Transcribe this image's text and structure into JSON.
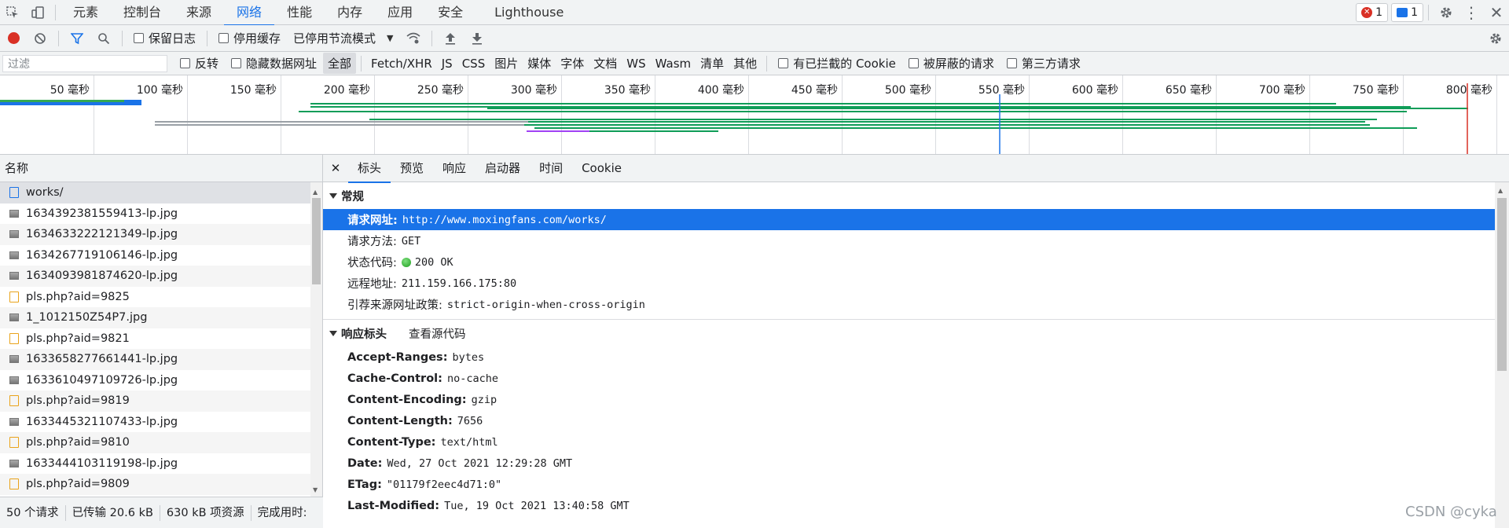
{
  "tabs": [
    {
      "label": "元素"
    },
    {
      "label": "控制台"
    },
    {
      "label": "来源"
    },
    {
      "label": "网络"
    },
    {
      "label": "性能"
    },
    {
      "label": "内存"
    },
    {
      "label": "应用"
    },
    {
      "label": "安全"
    },
    {
      "label": "Lighthouse"
    }
  ],
  "badges": {
    "errors": "1",
    "messages": "1"
  },
  "toolbar": {
    "preserve_log": "保留日志",
    "disable_cache": "停用缓存",
    "throttling": "已停用节流模式"
  },
  "filter": {
    "placeholder": "过滤",
    "invert": "反转",
    "hide_data_urls": "隐藏数据网址",
    "types": [
      "全部",
      "Fetch/XHR",
      "JS",
      "CSS",
      "图片",
      "媒体",
      "字体",
      "文档",
      "WS",
      "Wasm",
      "清单",
      "其他"
    ],
    "blocked_cookies": "有已拦截的 Cookie",
    "blocked_requests": "被屏蔽的请求",
    "third_party": "第三方请求"
  },
  "timeline": {
    "ticks": [
      "50 毫秒",
      "100 毫秒",
      "150 毫秒",
      "200 毫秒",
      "250 毫秒",
      "300 毫秒",
      "350 毫秒",
      "400 毫秒",
      "450 毫秒",
      "500 毫秒",
      "550 毫秒",
      "600 毫秒",
      "650 毫秒",
      "700 毫秒",
      "750 毫秒",
      "800 毫秒"
    ]
  },
  "request_list": {
    "header": "名称",
    "rows": [
      {
        "name": "works/",
        "type": "doc"
      },
      {
        "name": "1634392381559413-lp.jpg",
        "type": "img"
      },
      {
        "name": "1634633222121349-lp.jpg",
        "type": "img"
      },
      {
        "name": "1634267719106146-lp.jpg",
        "type": "img"
      },
      {
        "name": "1634093981874620-lp.jpg",
        "type": "img"
      },
      {
        "name": "pls.php?aid=9825",
        "type": "scr"
      },
      {
        "name": "1_1012150Z54P7.jpg",
        "type": "img"
      },
      {
        "name": "pls.php?aid=9821",
        "type": "scr"
      },
      {
        "name": "1633658277661441-lp.jpg",
        "type": "img"
      },
      {
        "name": "1633610497109726-lp.jpg",
        "type": "img"
      },
      {
        "name": "pls.php?aid=9819",
        "type": "scr"
      },
      {
        "name": "1633445321107433-lp.jpg",
        "type": "img"
      },
      {
        "name": "pls.php?aid=9810",
        "type": "scr"
      },
      {
        "name": "1633444103119198-lp.jpg",
        "type": "img"
      },
      {
        "name": "pls.php?aid=9809",
        "type": "scr"
      }
    ]
  },
  "status": {
    "requests": "50 个请求",
    "transferred": "已传输 20.6 kB",
    "resources": "630 kB 项资源",
    "finish": "完成用时:"
  },
  "detail_tabs": [
    "标头",
    "预览",
    "响应",
    "启动器",
    "时间",
    "Cookie"
  ],
  "general": {
    "title": "常规",
    "rows": [
      {
        "key": "请求网址:",
        "value": "http://www.moxingfans.com/works/"
      },
      {
        "key": "请求方法:",
        "value": "GET"
      },
      {
        "key": "状态代码:",
        "value": "200 OK"
      },
      {
        "key": "远程地址:",
        "value": "211.159.166.175:80"
      },
      {
        "key": "引荐来源网址政策:",
        "value": "strict-origin-when-cross-origin"
      }
    ]
  },
  "response_headers": {
    "title": "响应标头",
    "view_source": "查看源代码",
    "rows": [
      {
        "key": "Accept-Ranges:",
        "value": "bytes"
      },
      {
        "key": "Cache-Control:",
        "value": "no-cache"
      },
      {
        "key": "Content-Encoding:",
        "value": "gzip"
      },
      {
        "key": "Content-Length:",
        "value": "7656"
      },
      {
        "key": "Content-Type:",
        "value": "text/html"
      },
      {
        "key": "Date:",
        "value": "Wed, 27 Oct 2021 12:29:28 GMT"
      },
      {
        "key": "ETag:",
        "value": "\"01179f2eec4d71:0\""
      },
      {
        "key": "Last-Modified:",
        "value": "Tue, 19 Oct 2021 13:40:58 GMT"
      }
    ]
  },
  "watermark": "CSDN @cyka"
}
